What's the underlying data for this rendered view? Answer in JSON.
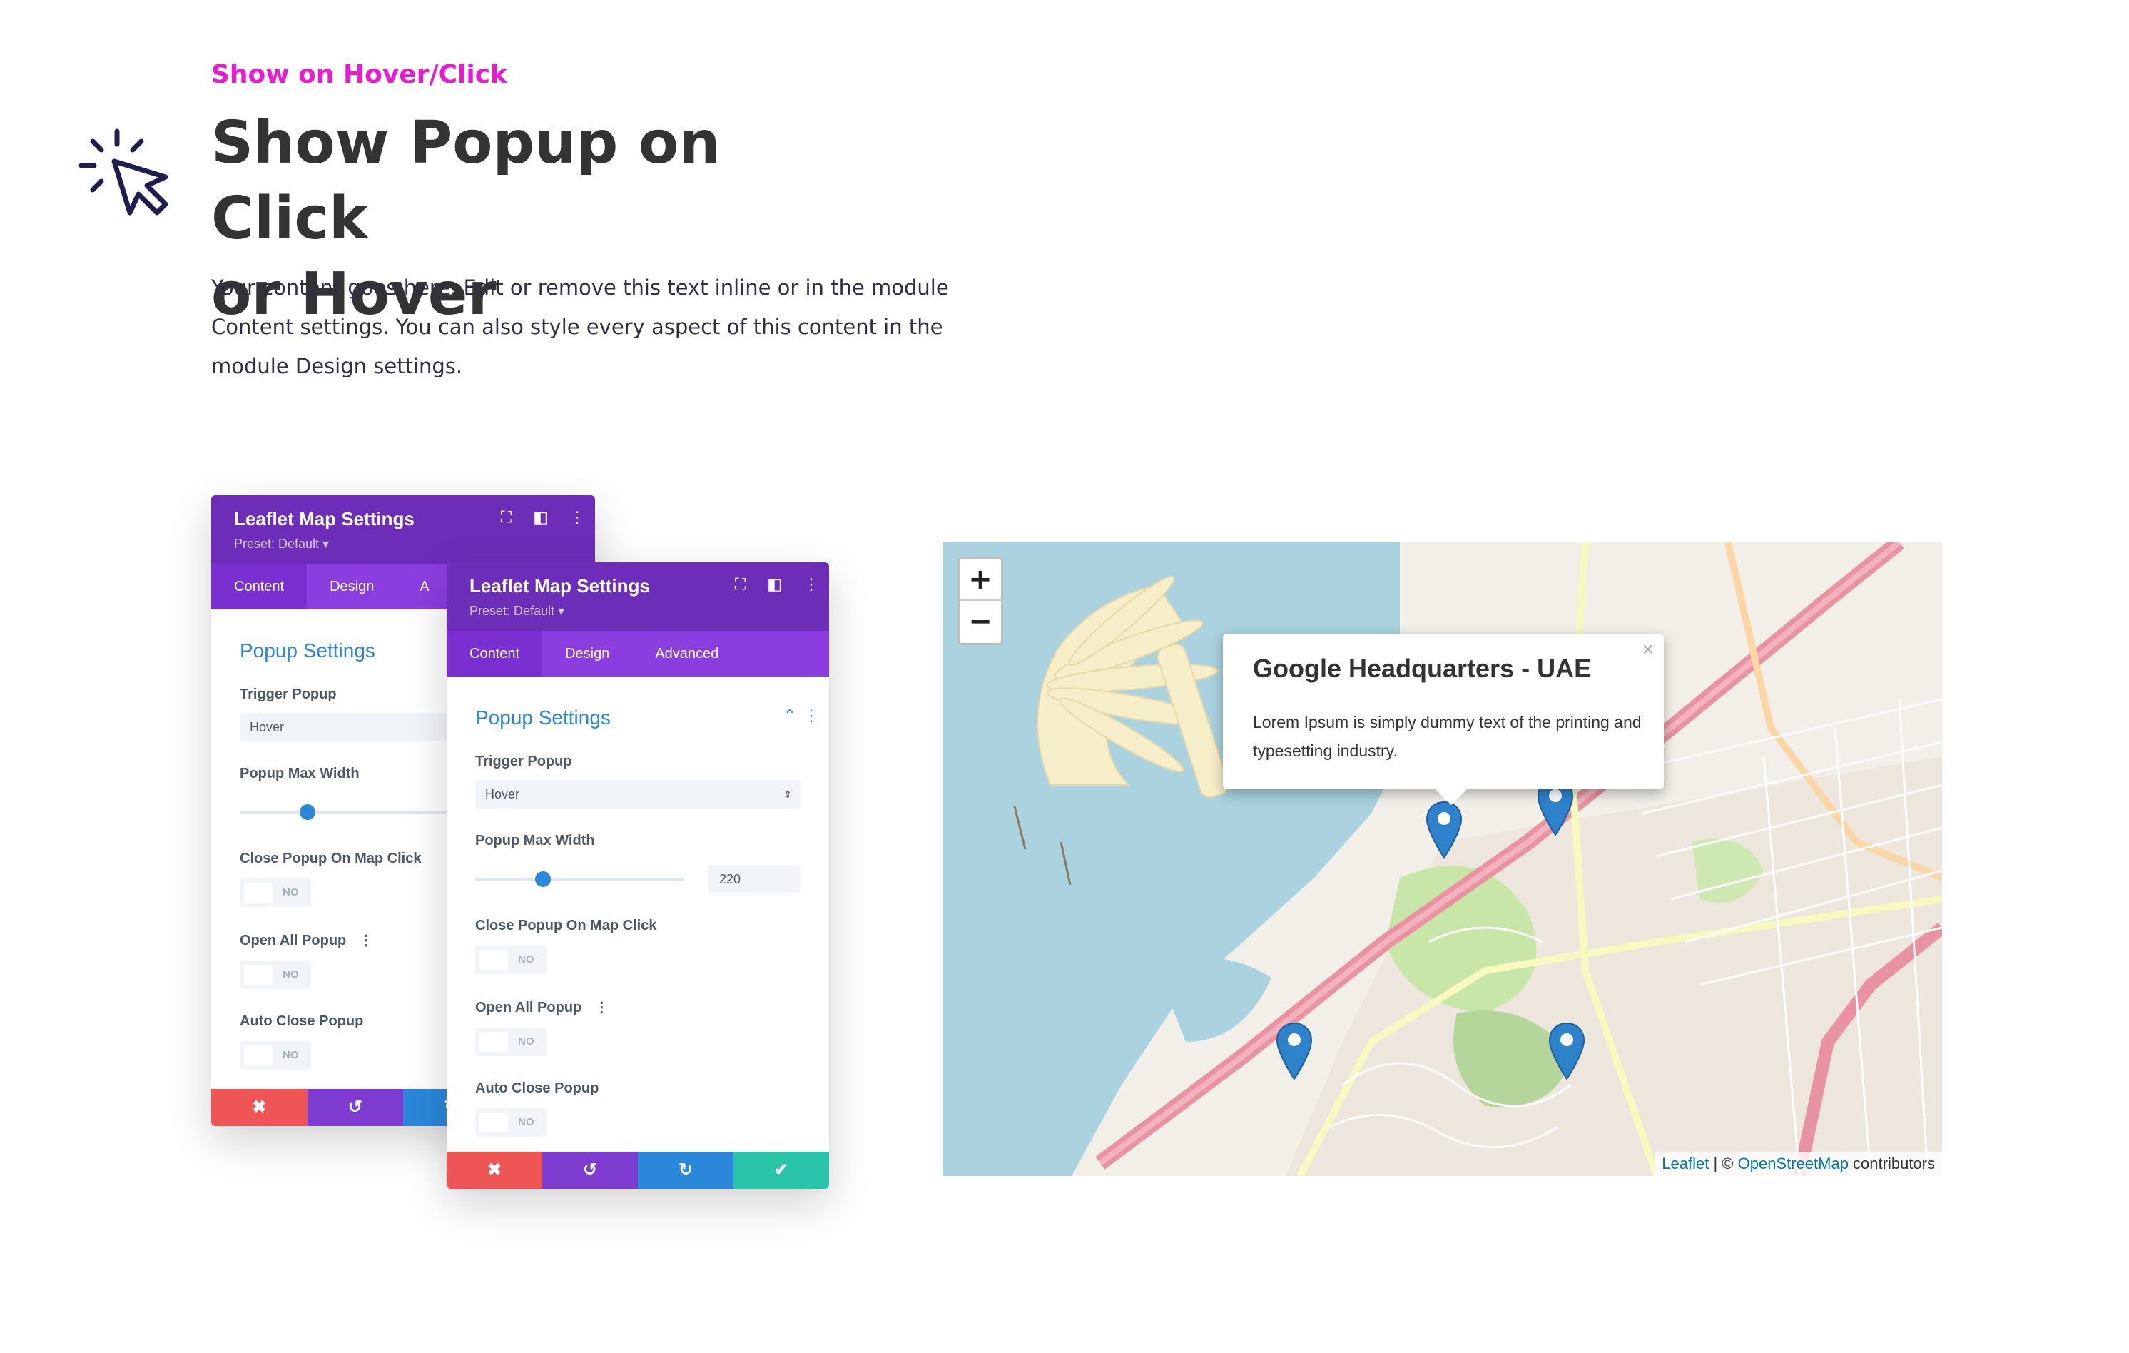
{
  "header": {
    "eyebrow": "Show on Hover/Click",
    "title_line1": "Show Popup on Click",
    "title_line2": "or Hover",
    "description": "Your content goes here. Edit or remove this text inline or in the module Content settings. You can also style every aspect of this content in the module Design settings.",
    "icon": "cursor-click-icon"
  },
  "panel_back": {
    "title": "Leaflet Map Settings",
    "preset": "Preset: Default ▾",
    "tabs": [
      "Content",
      "Design",
      "A"
    ],
    "section": "Popup Settings",
    "trigger_label": "Trigger Popup",
    "trigger_value": "Hover",
    "max_width_label": "Popup Max Width",
    "close_label": "Close Popup On Map Click",
    "open_all_label": "Open All Popup",
    "auto_close_label": "Auto Close Popup",
    "toggle_text": "NO"
  },
  "panel_front": {
    "title": "Leaflet Map Settings",
    "preset": "Preset: Default ▾",
    "tabs": [
      "Content",
      "Design",
      "Advanced"
    ],
    "section": "Popup Settings",
    "trigger_label": "Trigger Popup",
    "trigger_value": "Hover",
    "max_width_label": "Popup Max Width",
    "max_width_value": "220",
    "close_label": "Close Popup On Map Click",
    "open_all_label": "Open All Popup",
    "auto_close_label": "Auto Close Popup",
    "toggle_text": "NO"
  },
  "footer_icons": [
    "close-icon",
    "undo-icon",
    "redo-icon",
    "check-icon"
  ],
  "map": {
    "zoom_in": "+",
    "zoom_out": "−",
    "popup_title": "Google Headquarters - UAE",
    "popup_text": "Lorem Ipsum is simply dummy text of the printing and typesetting industry.",
    "popup_close": "×",
    "attribution_leaflet": "Leaflet",
    "attribution_sep": " | © ",
    "attribution_osm": "OpenStreetMap",
    "attribution_suffix": " contributors",
    "marker_color": "#2e82cb"
  },
  "colors": {
    "accent_pink": "#e91ad2",
    "header_purple": "#6c2eb9",
    "tab_purple": "#8b3ee0",
    "link_blue": "#2b87da"
  }
}
